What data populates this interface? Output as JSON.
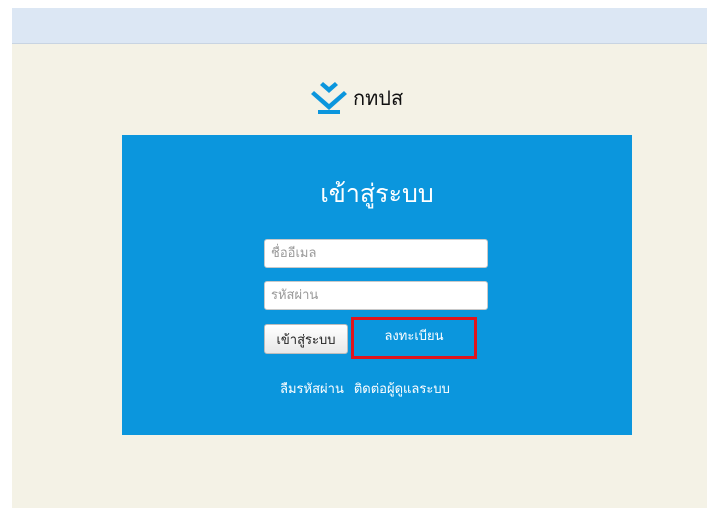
{
  "brand": {
    "name": "กทปส",
    "logo_icon": "chevron-stack-logo",
    "logo_color": "#0b96dd"
  },
  "login_panel": {
    "title": "เข้าสู่ระบบ",
    "background_color": "#0b96dd",
    "email_placeholder": "ชื่ออีเมล",
    "password_placeholder": "รหัสผ่าน",
    "login_button_label": "เข้าสู่ระบบ",
    "register_button_label": "ลงทะเบียน",
    "register_highlight_color": "#e0141e",
    "forgot_password_link": "ลืมรหัสผ่าน",
    "contact_admin_link": "ติดต่อผู้ดูแลระบบ"
  }
}
